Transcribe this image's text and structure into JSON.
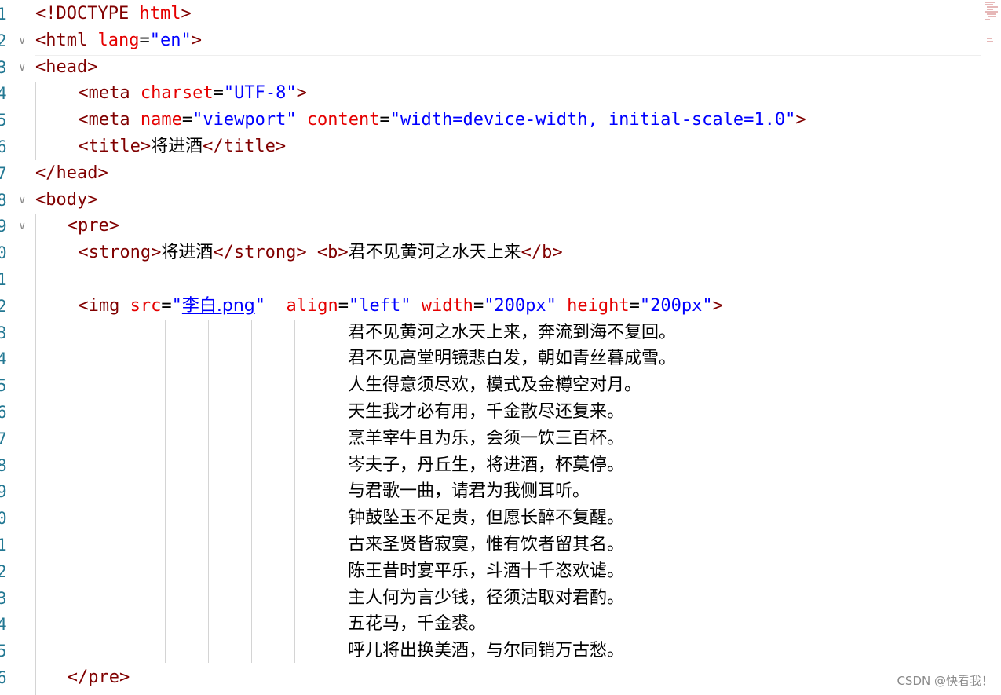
{
  "editor": {
    "lines": [
      {
        "num": "1",
        "fold": "",
        "tokens": [
          {
            "t": "<!DOCTYPE ",
            "c": "tag"
          },
          {
            "t": "html",
            "c": "attr"
          },
          {
            "t": ">",
            "c": "tag"
          }
        ]
      },
      {
        "num": "2",
        "fold": "v",
        "tokens": [
          {
            "t": "<html ",
            "c": "tag"
          },
          {
            "t": "lang",
            "c": "attr"
          },
          {
            "t": "=",
            "c": "txt"
          },
          {
            "t": "\"en\"",
            "c": "str"
          },
          {
            "t": ">",
            "c": "tag"
          }
        ]
      },
      {
        "num": "3",
        "fold": "v",
        "tokens": [
          {
            "t": "<head>",
            "c": "tag"
          }
        ]
      },
      {
        "num": "4",
        "fold": "",
        "indent": 4,
        "tokens": [
          {
            "t": "<meta ",
            "c": "tag"
          },
          {
            "t": "charset",
            "c": "attr"
          },
          {
            "t": "=",
            "c": "txt"
          },
          {
            "t": "\"UTF-8\"",
            "c": "str"
          },
          {
            "t": ">",
            "c": "tag"
          }
        ]
      },
      {
        "num": "5",
        "fold": "",
        "indent": 4,
        "tokens": [
          {
            "t": "<meta ",
            "c": "tag"
          },
          {
            "t": "name",
            "c": "attr"
          },
          {
            "t": "=",
            "c": "txt"
          },
          {
            "t": "\"viewport\" ",
            "c": "str"
          },
          {
            "t": "content",
            "c": "attr"
          },
          {
            "t": "=",
            "c": "txt"
          },
          {
            "t": "\"width=device-width, initial-scale=1.0\"",
            "c": "str"
          },
          {
            "t": ">",
            "c": "tag"
          }
        ]
      },
      {
        "num": "6",
        "fold": "",
        "indent": 4,
        "tokens": [
          {
            "t": "<title>",
            "c": "tag"
          },
          {
            "t": "将进酒",
            "c": "txt cn"
          },
          {
            "t": "</title>",
            "c": "tag"
          }
        ]
      },
      {
        "num": "7",
        "fold": "",
        "tokens": [
          {
            "t": "</head>",
            "c": "tag"
          }
        ]
      },
      {
        "num": "8",
        "fold": "v",
        "tokens": [
          {
            "t": "<body>",
            "c": "tag"
          }
        ]
      },
      {
        "num": "9",
        "fold": "v",
        "indent": 3,
        "tokens": [
          {
            "t": "<pre>",
            "c": "tag"
          }
        ]
      },
      {
        "num": "0",
        "fold": "",
        "indent": 4,
        "tokens": [
          {
            "t": "<strong>",
            "c": "tag"
          },
          {
            "t": "将进酒",
            "c": "txt cn"
          },
          {
            "t": "</strong> ",
            "c": "tag"
          },
          {
            "t": "<b>",
            "c": "tag"
          },
          {
            "t": "君不见黄河之水天上来",
            "c": "txt cn"
          },
          {
            "t": "</b>",
            "c": "tag"
          }
        ]
      },
      {
        "num": "1",
        "fold": "",
        "tokens": []
      },
      {
        "num": "2",
        "fold": "",
        "indent": 4,
        "tokens": [
          {
            "t": "<img ",
            "c": "tag"
          },
          {
            "t": "src",
            "c": "attr"
          },
          {
            "t": "=",
            "c": "txt"
          },
          {
            "t": "\"",
            "c": "str"
          },
          {
            "t": "李白.png",
            "c": "link cn"
          },
          {
            "t": "\"  ",
            "c": "str"
          },
          {
            "t": "align",
            "c": "attr"
          },
          {
            "t": "=",
            "c": "txt"
          },
          {
            "t": "\"left\" ",
            "c": "str"
          },
          {
            "t": "width",
            "c": "attr"
          },
          {
            "t": "=",
            "c": "txt"
          },
          {
            "t": "\"200px\" ",
            "c": "str"
          },
          {
            "t": "height",
            "c": "attr"
          },
          {
            "t": "=",
            "c": "txt"
          },
          {
            "t": "\"200px\"",
            "c": "str"
          },
          {
            "t": ">",
            "c": "tag"
          }
        ]
      },
      {
        "num": "3",
        "fold": "",
        "poem": "君不见黄河之水天上来，奔流到海不复回。"
      },
      {
        "num": "4",
        "fold": "",
        "poem": "君不见高堂明镜悲白发，朝如青丝暮成雪。"
      },
      {
        "num": "5",
        "fold": "",
        "poem": "人生得意须尽欢，模式及金樽空对月。"
      },
      {
        "num": "6",
        "fold": "",
        "poem": "天生我才必有用，千金散尽还复来。"
      },
      {
        "num": "7",
        "fold": "",
        "poem": "烹羊宰牛且为乐，会须一饮三百杯。"
      },
      {
        "num": "8",
        "fold": "",
        "poem": "岑夫子，丹丘生，将进酒，杯莫停。"
      },
      {
        "num": "9",
        "fold": "",
        "poem": "与君歌一曲，请君为我侧耳听。"
      },
      {
        "num": "0",
        "fold": "",
        "poem": "钟鼓坠玉不足贵，但愿长醉不复醒。"
      },
      {
        "num": "1",
        "fold": "",
        "poem": "古来圣贤皆寂寞，惟有饮者留其名。"
      },
      {
        "num": "2",
        "fold": "",
        "poem": "陈王昔时宴平乐，斗酒十千恣欢谑。"
      },
      {
        "num": "3",
        "fold": "",
        "poem": "主人何为言少钱，径须沽取对君酌。"
      },
      {
        "num": "4",
        "fold": "",
        "poem": "五花马，千金裘。"
      },
      {
        "num": "5",
        "fold": "",
        "poem": "呼儿将出换美酒，与尔同销万古愁。"
      },
      {
        "num": "6",
        "fold": "",
        "indent": 3,
        "tokens": [
          {
            "t": "</pre>",
            "c": "tag"
          }
        ]
      }
    ]
  },
  "watermark": "CSDN @快看我！"
}
